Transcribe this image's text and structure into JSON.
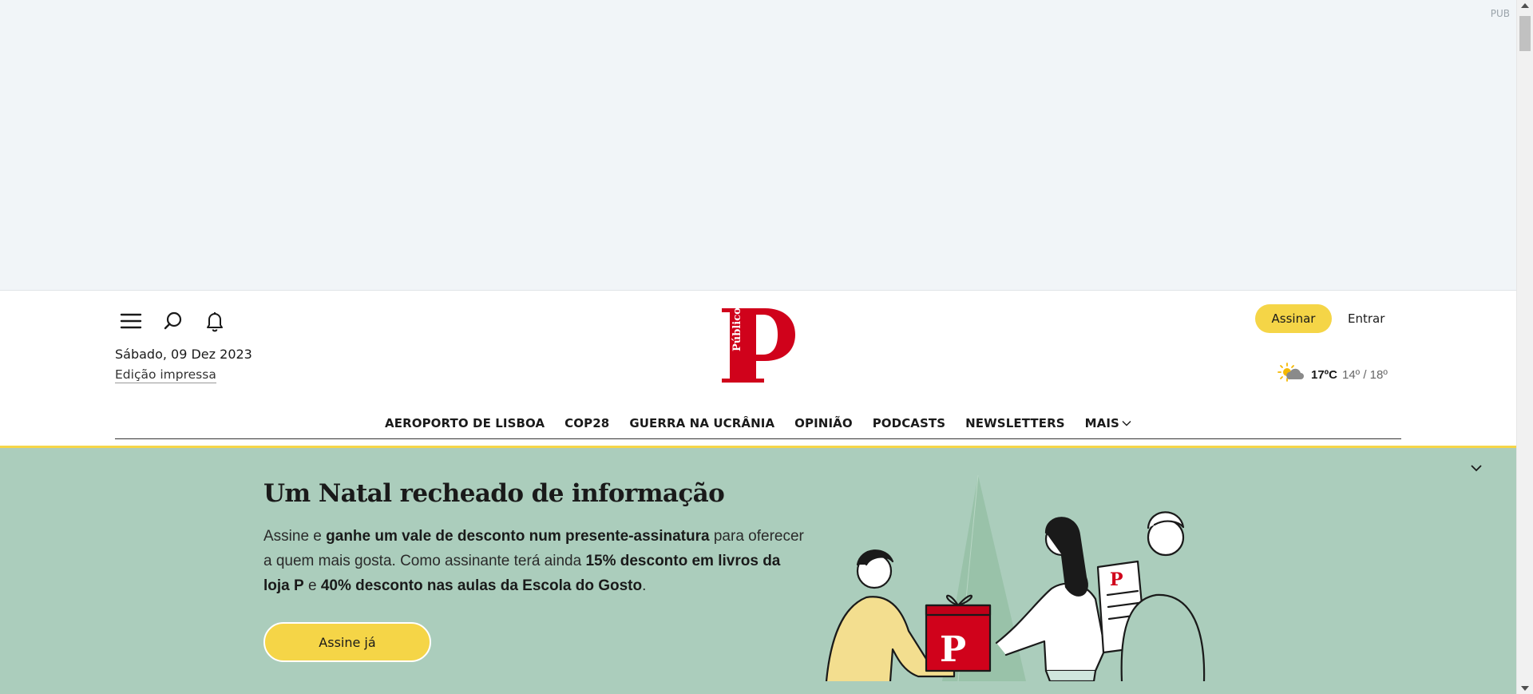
{
  "ad": {
    "label": "PUB"
  },
  "header": {
    "date": "Sábado, 09 Dez 2023",
    "edition_link": "Edição impressa",
    "logo_text": "Público",
    "subscribe_label": "Assinar",
    "login_label": "Entrar",
    "weather": {
      "temp": "17ºC",
      "range": "14º / 18º",
      "icon": "partly-sunny-icon"
    }
  },
  "nav": {
    "items": [
      "AEROPORTO DE LISBOA",
      "COP28",
      "GUERRA NA UCRÂNIA",
      "OPINIÃO",
      "PODCASTS",
      "NEWSLETTERS"
    ],
    "more_label": "MAIS"
  },
  "promo": {
    "title": "Um Natal recheado de informação",
    "text": {
      "p1": "Assine e ",
      "b1": "ganhe um vale de desconto num presente-assinatura",
      "p2": " para oferecer a quem mais gosta. Como assinante terá ainda ",
      "b2": "15% desconto em livros da loja P",
      "p3": " e ",
      "b3": "40% desconto nas aulas da Escola do Gosto",
      "p4": "."
    },
    "button_label": "Assine já"
  },
  "colors": {
    "accent": "#f5d547",
    "brand": "#d0021b",
    "promo_bg": "#abcdbc",
    "ad_bg": "#f1f5f8"
  }
}
